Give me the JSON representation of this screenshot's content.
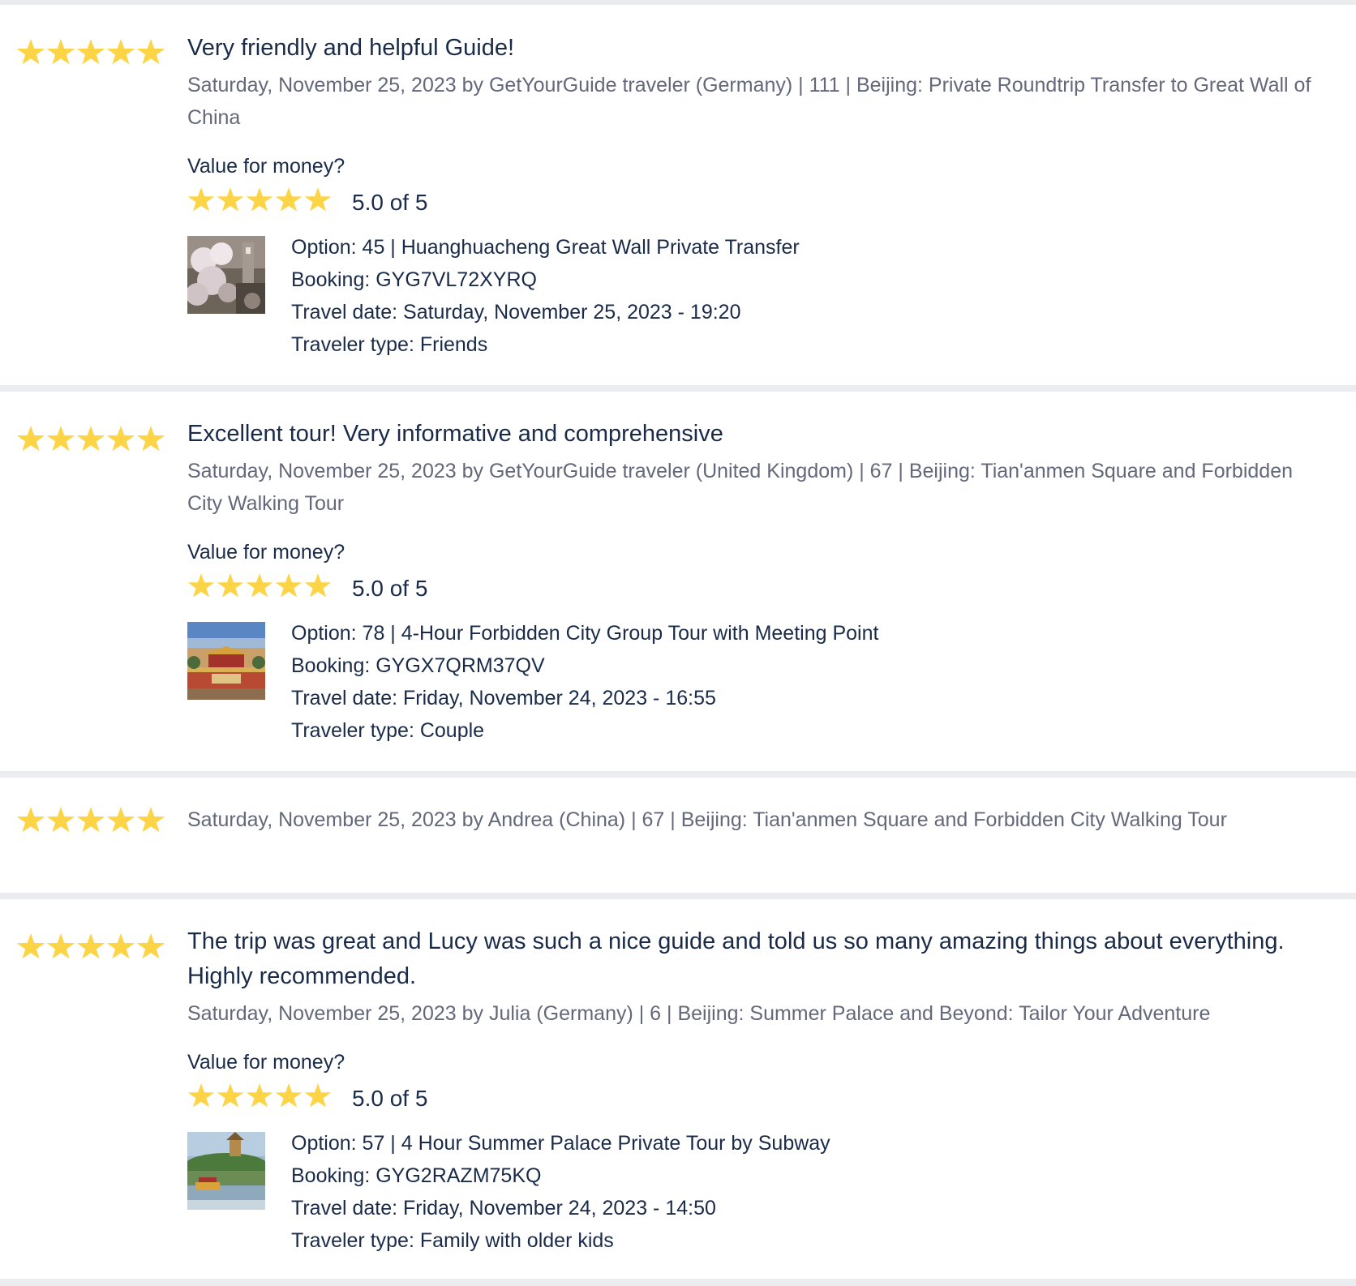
{
  "reviews": [
    {
      "rating": 5,
      "title": "Very friendly and helpful Guide!",
      "meta": "Saturday, November 25, 2023 by GetYourGuide traveler (Germany) | 111 | Beijing: Private Roundtrip Transfer to Great Wall of China",
      "value_label": "Value for money?",
      "value_rating": 5,
      "value_score": "5.0 of 5",
      "thumbnail": "great-wall-cherry-blossom-photo",
      "option": "Option: 45 | Huanghuacheng Great Wall Private Transfer",
      "booking": "Booking: GYG7VL72XYRQ",
      "travel_date": "Travel date: Saturday, November 25, 2023 - 19:20",
      "traveler_type": "Traveler type: Friends"
    },
    {
      "rating": 5,
      "title": "Excellent tour! Very informative and comprehensive",
      "meta": "Saturday, November 25, 2023 by GetYourGuide traveler (United Kingdom) | 67 | Beijing: Tian'anmen Square and Forbidden City Walking Tour",
      "value_label": "Value for money?",
      "value_rating": 5,
      "value_score": "5.0 of 5",
      "thumbnail": "forbidden-city-photo",
      "option": "Option: 78 | 4-Hour Forbidden City Group Tour with Meeting Point",
      "booking": "Booking: GYGX7QRM37QV",
      "travel_date": "Travel date: Friday, November 24, 2023 - 16:55",
      "traveler_type": "Traveler type: Couple"
    },
    {
      "rating": 5,
      "meta": "Saturday, November 25, 2023 by Andrea (China) | 67 | Beijing: Tian'anmen Square and Forbidden City Walking Tour"
    },
    {
      "rating": 5,
      "title": "The trip was great and Lucy was such a nice guide and told us so many amazing things about everything. Highly recommended.",
      "meta": "Saturday, November 25, 2023 by Julia (Germany) | 6 | Beijing: Summer Palace and Beyond: Tailor Your Adventure",
      "value_label": "Value for money?",
      "value_rating": 5,
      "value_score": "5.0 of 5",
      "thumbnail": "summer-palace-photo",
      "option": "Option: 57 | 4 Hour Summer Palace Private Tour by Subway",
      "booking": "Booking: GYG2RAZM75KQ",
      "travel_date": "Travel date: Friday, November 24, 2023 - 14:50",
      "traveler_type": "Traveler type: Family with older kids"
    }
  ],
  "colors": {
    "star": "#fdd446",
    "title": "#1a2b49",
    "meta": "#63687a",
    "background": "#ebecf0",
    "card": "#ffffff"
  }
}
